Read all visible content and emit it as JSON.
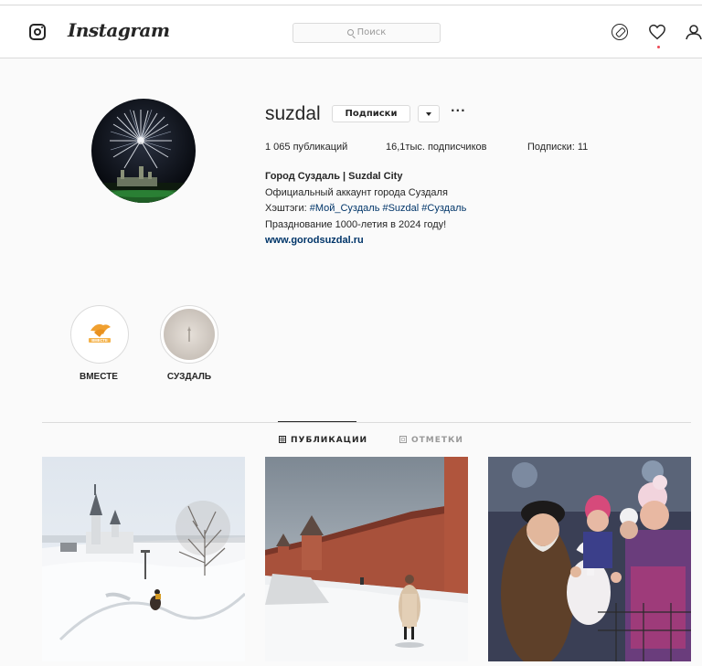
{
  "header": {
    "brand": "Instagram",
    "search": {
      "placeholder": "Поиск"
    },
    "icons": [
      "instagram-glyph-icon",
      "explore-compass-icon",
      "activity-heart-icon",
      "profile-person-icon"
    ]
  },
  "profile": {
    "username": "suzdal",
    "follow_button": "Подписки",
    "more": "···",
    "stats": {
      "posts": "1 065 публикаций",
      "followers": "16,1тыс. подписчиков",
      "following": "Подписки: 11"
    },
    "bio": {
      "name": "Город Суздаль | Suzdal City",
      "line1": "Официальный аккаунт города Суздаля",
      "hashtags_prefix": "Хэштэги: ",
      "hashtags": "#Мой_Суздаль #Suzdal #Суздаль",
      "line3": "Празднование 1000-летия в 2024 году!",
      "link": "www.gorodsuzdal.ru"
    }
  },
  "highlights": [
    {
      "label": "ВМЕСТЕ",
      "logo_text": "ВМЕСТЕ"
    },
    {
      "label": "СУЗДАЛЬ"
    }
  ],
  "tabs": [
    {
      "label": "ПУБЛИКАЦИИ",
      "active": true
    },
    {
      "label": "ОТМЕТКИ",
      "active": false
    }
  ],
  "colors": {
    "link": "#003569",
    "border": "#dbdbdb",
    "text": "#262626",
    "accent": "#ed4956"
  }
}
